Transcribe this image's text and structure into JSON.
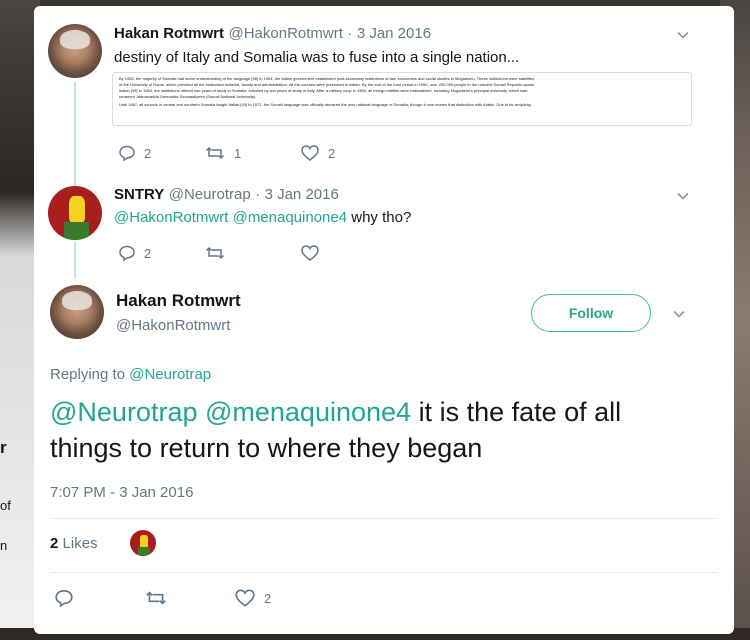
{
  "tweets": [
    {
      "name": "Hakan Rotmwrt",
      "handle": "@HakonRotmwrt",
      "sep": "·",
      "date": "3 Jan 2016",
      "text": "destiny of Italy and Somalia was to fuse into a single nation...",
      "replies": "2",
      "retweets": "1",
      "likes": "2"
    },
    {
      "name": "SNTRY",
      "handle": "@Neurotrap",
      "sep": "·",
      "date": "3 Jan 2016",
      "mentions": "@HakonRotmwrt @menaquinone4",
      "text": "why tho?",
      "replies": "2"
    }
  ],
  "attached_document": {
    "lines": [
      "By 1952, the majority of Somalis had some understanding of the language.[38] In 1954, the Italian government established post-secondary institutions of law, economics and social studies in Mogadishu. These institutions were satellites",
      "of the University of Rome, which provided all the instruction material, faculty and administration. All the courses were presented in Italian. By the end of the trust period in 1960, over 200,000 people in the nascent Somali Republic spoke",
      "Italian.[39] In 1964, the institutions offered two years of study in Somalia, followed by two years of study in Italy. After a military coup in 1969, all foreign entities were nationalized, including Mogadishu's principal university, which was",
      "renamed Jaamacadda Ummadda Soomaaliyeed (Somali National University).",
      "Until 1967, all schools in central and southern Somalia taught Italian.[40] In 1972, the Somali language was officially declared the only national language of Somalia, though it now shares that distinction with Arabic. Due to its simplicity,"
    ]
  },
  "focused_tweet": {
    "name": "Hakan Rotmwrt",
    "handle": "@HakonRotmwrt",
    "follow_label": "Follow",
    "replying_prefix": "Replying to",
    "replying_to": "@Neurotrap",
    "mentions": "@Neurotrap @menaquinone4",
    "text": "it is the fate of all things to return to where they began",
    "timestamp": "7:07 PM - 3 Jan 2016",
    "likes_count": "2",
    "likes_label": "Likes",
    "action_likes": "2"
  },
  "background_edge": {
    "glyph_1": "r",
    "glyph_2": "of",
    "glyph_3": "n"
  },
  "colors": {
    "accent": "#21a78f",
    "thread_line": "#bfe9d6",
    "secondary_text": "#657786"
  },
  "icons": [
    "chevron-down-icon",
    "reply-icon",
    "retweet-icon",
    "heart-icon"
  ]
}
